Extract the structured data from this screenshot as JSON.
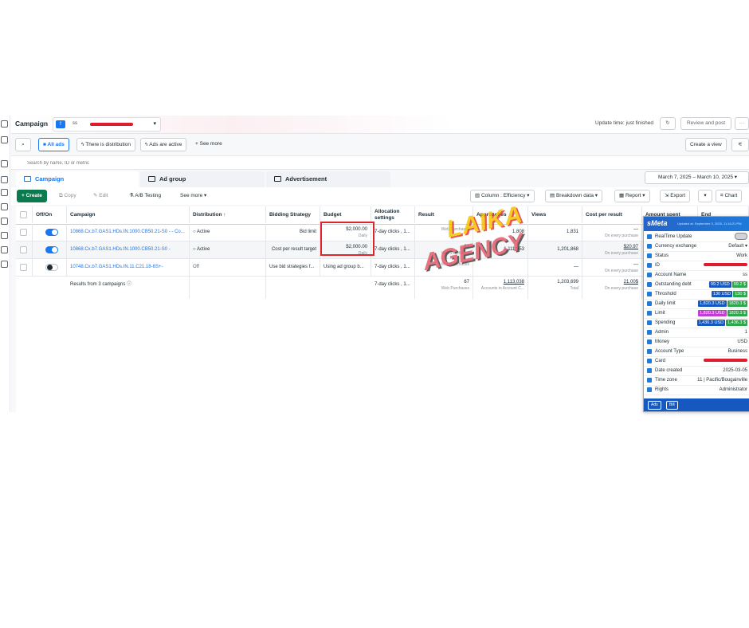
{
  "header": {
    "title": "Campaign",
    "account_prefix": "ss",
    "update_time": "Update time: just finished",
    "review_publish": "Review and post",
    "more": "···"
  },
  "filters": {
    "all_ads": "All ads",
    "there_is_distribution": "There is distribution",
    "ads_are_active": "Ads are active",
    "see_more": "See more",
    "create_view": "Create a view"
  },
  "search": {
    "placeholder": "Search by name, ID or metric"
  },
  "tabs": [
    "Campaign",
    "Ad group",
    "Advertisement"
  ],
  "date_range": "March 7, 2025 – March 10, 2025",
  "toolbar": {
    "create": "Create",
    "copy": "Copy",
    "edit": "Edit",
    "ab_testing": "A/B Testing",
    "see_more": "See more",
    "columns": "Column : Efficiency",
    "breakdown": "Breakdown data",
    "report": "Report",
    "export": "Export",
    "chart": "Chart"
  },
  "table": {
    "columns": [
      "Off/On",
      "Campaign",
      "Distribution ↑",
      "Bidding Strategy",
      "Budget",
      "Allocation settings",
      "Result",
      "Approaches",
      "Views",
      "Cost per result",
      "Amount spent",
      "End"
    ],
    "rows": [
      {
        "on": true,
        "campaign": "10868.Cx.b7.GAS1.HDs.IN.1000.CB50.21-S0 - - Co...",
        "distribution": "Active",
        "bidding": "Bid limit",
        "budget": "$2,000.00",
        "budget_sub": "Daily",
        "allocation": "7-day clicks , 1...",
        "result": "",
        "result_sub": "Web Purchases",
        "approaches": "1,808",
        "views": "1,831",
        "cpr": "—",
        "cpr_sub": "On every purchase"
      },
      {
        "on": true,
        "campaign": "10868.Cx.b7.GAS1.HDs.IN.1000.CB50.21-S0 -",
        "distribution": "Active",
        "bidding": "Cost per result target",
        "budget": "$2,000.00",
        "budget_sub": "Daily",
        "allocation": "7-day clicks , 1...",
        "result": "67",
        "result_sub": "Web Purchases",
        "approaches": "1,111,953",
        "views": "1,201,868",
        "cpr": "$20.97",
        "cpr_sub": "On every purchase"
      },
      {
        "on": false,
        "campaign": "10748.Cx.b7.GAS1.HDs.IN.11.C21.18-6S+-",
        "distribution": "Off",
        "bidding": "Use bid strategies f...",
        "budget": "Using ad group b...",
        "budget_sub": "",
        "allocation": "7-day clicks , 1...",
        "result": "",
        "result_sub": "Web Purchases",
        "approaches": "",
        "views": "—",
        "cpr": "—",
        "cpr_sub": "On every purchase"
      }
    ],
    "totals": {
      "label": "Results from 3 campaigns",
      "allocation": "7-day clicks , 1...",
      "result": "67",
      "result_sub": "Web Purchases",
      "approaches": "1,113,038",
      "approaches_sub": "Accounts in Account C...",
      "views": "1,203,699",
      "views_sub": "Total",
      "cpr": "21.00$",
      "cpr_sub": "On every purchase"
    }
  },
  "panel": {
    "brand": "sMeta",
    "updated": "Updated at: September 3, 2025, 11:16:21 PM",
    "rows": [
      {
        "key": "RealTime Update",
        "value": "",
        "icon_color": "#1e7bd9"
      },
      {
        "key": "Currency exchange",
        "value": "Default ▾",
        "icon_color": "#1e7bd9"
      },
      {
        "key": "Status",
        "value": "Work",
        "icon_color": "#1e7bd9"
      },
      {
        "key": "ID",
        "value": "",
        "icon_color": "#1e7bd9"
      },
      {
        "key": "Account Name",
        "value": "ss",
        "icon_color": "#1e7bd9"
      },
      {
        "key": "Outstanding debt",
        "value": "",
        "pills": [
          [
            "99.2 USD",
            "#1558c0"
          ],
          [
            "99.2 $",
            "#2aa84a"
          ]
        ],
        "icon_color": "#1e7bd9"
      },
      {
        "key": "Throshold",
        "value": "",
        "pills": [
          [
            "130 USD",
            "#1558c0"
          ],
          [
            "130 $",
            "#2aa84a"
          ]
        ],
        "icon_color": "#1e7bd9"
      },
      {
        "key": "Daily limit",
        "value": "",
        "pills": [
          [
            "1,820.3 USD",
            "#1558c0"
          ],
          [
            "1820.3 $",
            "#2aa84a"
          ]
        ],
        "icon_color": "#1e7bd9"
      },
      {
        "key": "Limit",
        "value": "",
        "pills": [
          [
            "1,820.3 USD",
            "#c23bd4"
          ],
          [
            "1820.3 $",
            "#2aa84a"
          ]
        ],
        "icon_color": "#1e7bd9"
      },
      {
        "key": "Spending",
        "value": "",
        "pills": [
          [
            "1,436.3 USD",
            "#1558c0"
          ],
          [
            "1,436.3 $",
            "#2aa84a"
          ]
        ],
        "icon_color": "#1e7bd9"
      },
      {
        "key": "Admin",
        "value": "1",
        "icon_color": "#1e7bd9"
      },
      {
        "key": "Money",
        "value": "USD",
        "icon_color": "#1e7bd9"
      },
      {
        "key": "Account Type",
        "value": "Business",
        "icon_color": "#1e7bd9"
      },
      {
        "key": "Card",
        "value": "",
        "icon_color": "#1e7bd9"
      },
      {
        "key": "Date created",
        "value": "2025-03-05",
        "icon_color": "#1e7bd9"
      },
      {
        "key": "Time zone",
        "value": "11 | Pacific/Bougainville",
        "icon_color": "#1e7bd9"
      },
      {
        "key": "Rights",
        "value": "Administrator",
        "icon_color": "#1e7bd9"
      }
    ],
    "footer": [
      "Ads",
      "Bill"
    ]
  },
  "watermark": [
    "LAIKA",
    "AGENCY"
  ]
}
